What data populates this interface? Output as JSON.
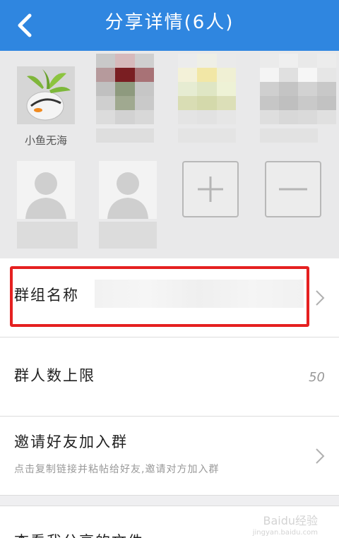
{
  "header": {
    "title": "分享详情(6人)",
    "back_icon": "back-chevron-icon",
    "bg_color": "#2f86e0"
  },
  "members": [
    {
      "name": "小鱼无海",
      "avatar": "fishbowl-plant-photo"
    },
    {
      "name": "",
      "avatar": "blurred"
    },
    {
      "name": "",
      "avatar": "blurred"
    },
    {
      "name": "",
      "avatar": "blurred"
    },
    {
      "name": "",
      "avatar": "default-person-icon"
    },
    {
      "name": "",
      "avatar": "default-person-icon"
    }
  ],
  "controls": {
    "add_icon": "plus-icon",
    "remove_icon": "minus-icon"
  },
  "settings": {
    "group_name_label": "群组名称",
    "member_limit_label": "群人数上限",
    "member_limit_value": "50",
    "invite_label": "邀请好友加入群",
    "invite_sub": "点击复制链接并粘帖给好友,邀请对方加入群",
    "shared_files_label": "查看我分享的文件"
  },
  "watermark": {
    "text": "Baidu经验",
    "sub": "jingyan.baidu.com"
  },
  "colors": {
    "highlight": "#e52020"
  }
}
